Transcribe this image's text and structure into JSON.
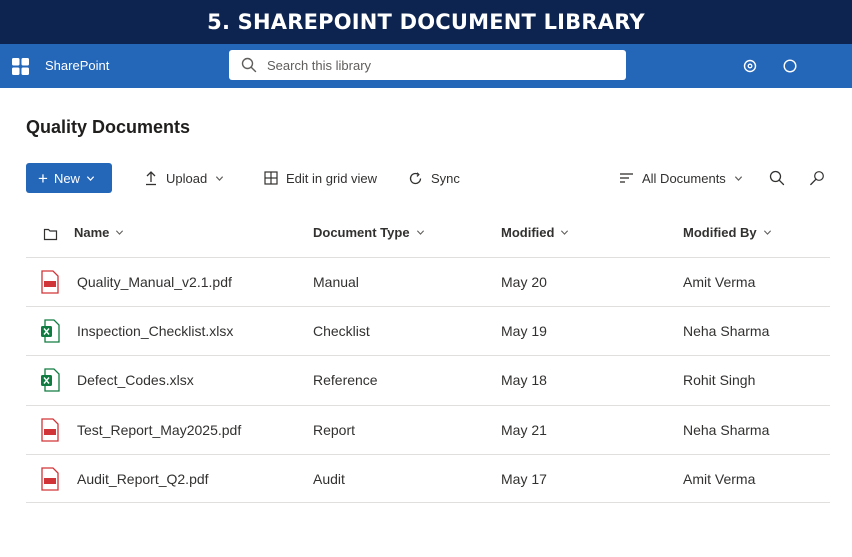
{
  "banner": {
    "title": "5. SHAREPOINT DOCUMENT LIBRARY"
  },
  "suitebar": {
    "app_name": "SharePoint",
    "search_placeholder": "Search this library",
    "icons": [
      "app-launcher-icon",
      "search-icon",
      "settings-icon",
      "help-icon"
    ]
  },
  "library": {
    "title": "Quality Documents",
    "commands": {
      "new_label": "New",
      "upload_label": "Upload",
      "grid_label": "Edit in grid view",
      "sync_label": "Sync",
      "view_label": "All Documents"
    },
    "columns": {
      "name": "Name",
      "type": "Document Type",
      "modified": "Modified",
      "modified_by": "Modified By"
    },
    "files": [
      {
        "name": "Quality_Manual_v2.1.pdf",
        "type": "Manual",
        "modified": "May 20",
        "modified_by": "Amit Verma",
        "kind": "pdf"
      },
      {
        "name": "Inspection_Checklist.xlsx",
        "type": "Checklist",
        "modified": "May 19",
        "modified_by": "Neha Sharma",
        "kind": "xlsx"
      },
      {
        "name": "Defect_Codes.xlsx",
        "type": "Reference",
        "modified": "May 18",
        "modified_by": "Rohit Singh",
        "kind": "xlsx"
      },
      {
        "name": "Test_Report_May2025.pdf",
        "type": "Report",
        "modified": "May 21",
        "modified_by": "Neha Sharma",
        "kind": "pdf"
      },
      {
        "name": "Audit_Report_Q2.pdf",
        "type": "Audit",
        "modified": "May 17",
        "modified_by": "Amit Verma",
        "kind": "pdf"
      }
    ]
  },
  "colors": {
    "banner": "#0d2350",
    "suitebar": "#2466b8",
    "accent": "#2466b8",
    "pdf": "#d13438",
    "xlsx": "#107c41"
  }
}
